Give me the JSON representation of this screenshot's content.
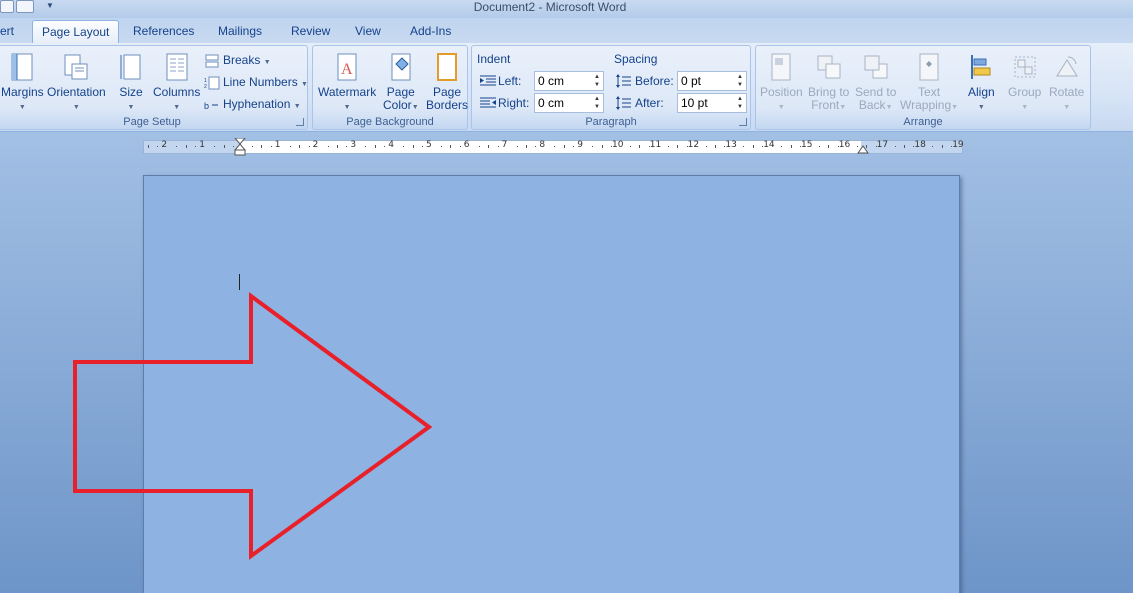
{
  "window": {
    "title": "Document2 - Microsoft Word"
  },
  "tabs": [
    {
      "label": "ert"
    },
    {
      "label": "Page Layout",
      "active": true
    },
    {
      "label": "References"
    },
    {
      "label": "Mailings"
    },
    {
      "label": "Review"
    },
    {
      "label": "View"
    },
    {
      "label": "Add-Ins"
    }
  ],
  "page_setup": {
    "label": "Page Setup",
    "margins": "Margins",
    "orientation": "Orientation",
    "size": "Size",
    "columns": "Columns",
    "breaks": "Breaks",
    "line_numbers": "Line Numbers",
    "hyphenation": "Hyphenation"
  },
  "page_background": {
    "label": "Page Background",
    "watermark": "Watermark",
    "page_color_1": "Page",
    "page_color_2": "Color",
    "page_borders_1": "Page",
    "page_borders_2": "Borders"
  },
  "paragraph": {
    "label": "Paragraph",
    "indent_title": "Indent",
    "left_label": "Left:",
    "left_value": "0 cm",
    "right_label": "Right:",
    "right_value": "0 cm",
    "spacing_title": "Spacing",
    "before_label": "Before:",
    "before_value": "0 pt",
    "after_label": "After:",
    "after_value": "10 pt"
  },
  "arrange": {
    "label": "Arrange",
    "position": "Position",
    "bring_front_1": "Bring to",
    "bring_front_2": "Front",
    "send_back_1": "Send to",
    "send_back_2": "Back",
    "text_wrap_1": "Text",
    "text_wrap_2": "Wrapping",
    "align": "Align",
    "group": "Group",
    "rotate": "Rotate"
  },
  "ruler": {
    "labels_left": [
      "2",
      "1"
    ],
    "labels_right": [
      "1",
      "2",
      "3",
      "4",
      "5",
      "6",
      "7",
      "8",
      "9",
      "10",
      "11",
      "12",
      "13",
      "14",
      "15",
      "16",
      "17",
      "18",
      "19"
    ]
  },
  "colors": {
    "page_fill": "#8eb2e1",
    "arrow_stroke": "#e8202a",
    "ribbon_text": "#15428b"
  }
}
